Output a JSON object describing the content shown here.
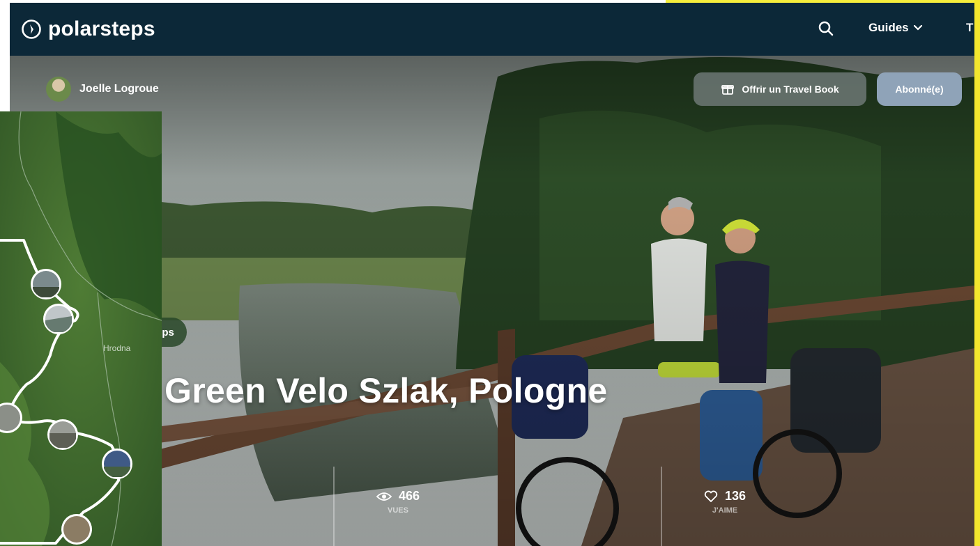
{
  "header": {
    "brand": "polarsteps",
    "nav_guides": "Guides",
    "nav_more": "T"
  },
  "hero": {
    "author_name": "Joelle Logroue",
    "gift_button": "Offrir un Travel Book",
    "subscribe_button": "Abonné(e)",
    "tag_label": "eps",
    "trip_title": "Green Velo Szlak, Pologne",
    "stats": {
      "views_count": "466",
      "views_label": "VUES",
      "likes_count": "136",
      "likes_label": "J'AIME"
    }
  },
  "map": {
    "city_label": "Hrodna"
  },
  "icons": {
    "logo": "compass-logo-icon",
    "search": "search-icon",
    "chevron": "chevron-down-icon",
    "gift": "gift-icon",
    "views": "eye-icon",
    "likes": "heart-icon"
  },
  "colors": {
    "header_bg": "#0c2838",
    "subscribe_bg": "#8fa3b8",
    "route_line": "#ffffff",
    "frame_yellow": "#f3e62e"
  }
}
